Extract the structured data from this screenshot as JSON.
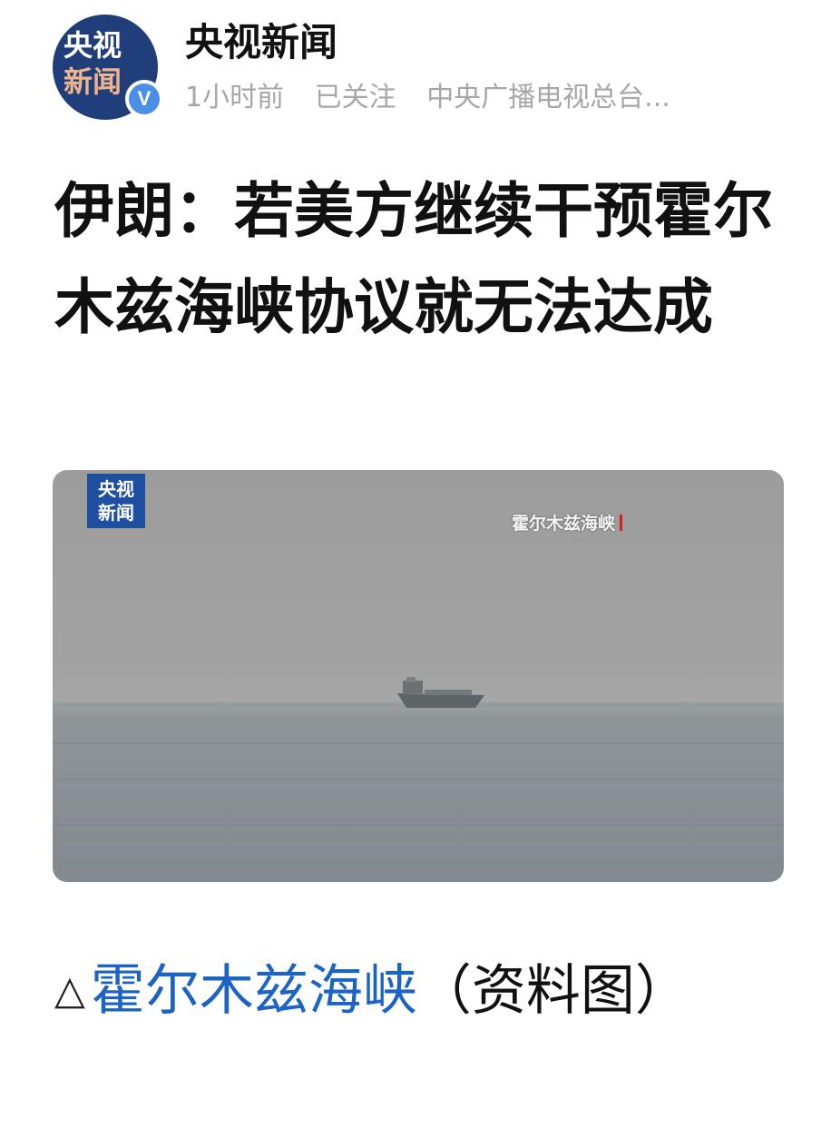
{
  "account": {
    "avatar_line1": "央视",
    "avatar_line2": "新闻",
    "verified_badge": "V",
    "name": "央视新闻",
    "time": "1小时前",
    "follow_status": "已关注",
    "org": "中央广播电视总台..."
  },
  "article": {
    "headline": "伊朗：若美方继续干预霍尔木兹海峡协议就无法达成",
    "image": {
      "logo_line1": "央视",
      "logo_line2": "新闻",
      "overlay_caption": "霍尔木兹海峡",
      "logo_color": "#1e4fa0",
      "accent_bar_color": "#d42020"
    },
    "caption": {
      "triangle": "△",
      "link_text": "霍尔木兹海峡",
      "rest": "（资料图）"
    }
  },
  "colors": {
    "link": "#1b63c4",
    "meta_text": "#a7a7a7",
    "avatar_bg": "#1f3e7a",
    "verified_bg": "#4a8ee8"
  }
}
